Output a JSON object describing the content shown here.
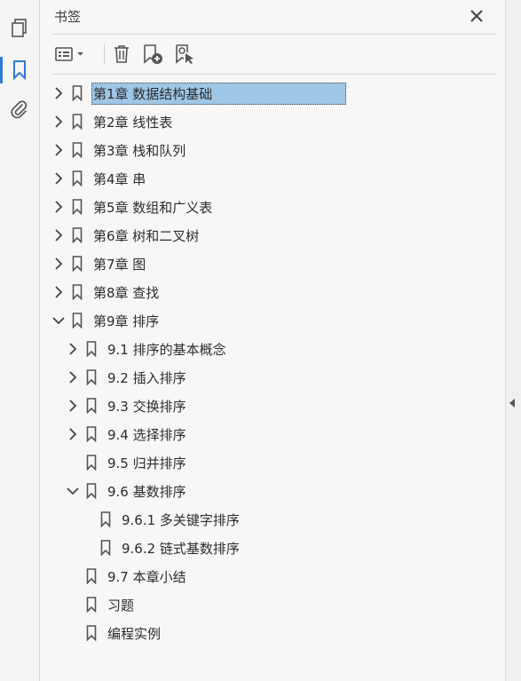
{
  "panel": {
    "title": "书签"
  },
  "sidebar": {
    "items": [
      {
        "name": "pages-thumbnail-icon"
      },
      {
        "name": "bookmark-icon",
        "selected": true
      },
      {
        "name": "attachment-icon"
      }
    ]
  },
  "toolbar": {
    "options_icon": "list-options-icon",
    "delete_icon": "trash-icon",
    "new_bookmark_icon": "add-bookmark-icon",
    "new_from_selection_icon": "bookmark-select-icon"
  },
  "bookmarks": [
    {
      "label": "第1章 数据结构基础",
      "level": 0,
      "state": "collapsed",
      "selected": true
    },
    {
      "label": "第2章 线性表",
      "level": 0,
      "state": "collapsed"
    },
    {
      "label": "第3章 栈和队列",
      "level": 0,
      "state": "collapsed"
    },
    {
      "label": "第4章 串",
      "level": 0,
      "state": "collapsed"
    },
    {
      "label": "第5章 数组和广义表",
      "level": 0,
      "state": "collapsed"
    },
    {
      "label": "第6章 树和二叉树",
      "level": 0,
      "state": "collapsed"
    },
    {
      "label": "第7章 图",
      "level": 0,
      "state": "collapsed"
    },
    {
      "label": "第8章 查找",
      "level": 0,
      "state": "collapsed"
    },
    {
      "label": "第9章 排序",
      "level": 0,
      "state": "expanded"
    },
    {
      "label": "9.1 排序的基本概念",
      "level": 1,
      "state": "collapsed"
    },
    {
      "label": "9.2 插入排序",
      "level": 1,
      "state": "collapsed"
    },
    {
      "label": "9.3 交换排序",
      "level": 1,
      "state": "collapsed"
    },
    {
      "label": "9.4 选择排序",
      "level": 1,
      "state": "collapsed"
    },
    {
      "label": "9.5 归并排序",
      "level": 1,
      "state": "leaf"
    },
    {
      "label": "9.6 基数排序",
      "level": 1,
      "state": "expanded"
    },
    {
      "label": "9.6.1 多关键字排序",
      "level": 2,
      "state": "leaf"
    },
    {
      "label": "9.6.2 链式基数排序",
      "level": 2,
      "state": "leaf"
    },
    {
      "label": "9.7 本章小结",
      "level": 1,
      "state": "leaf"
    },
    {
      "label": "习题",
      "level": 1,
      "state": "leaf"
    },
    {
      "label": "编程实例",
      "level": 1,
      "state": "leaf"
    }
  ],
  "colors": {
    "accent": "#2f7bd4",
    "selection": "#9ec6e6",
    "icon": "#555555"
  }
}
